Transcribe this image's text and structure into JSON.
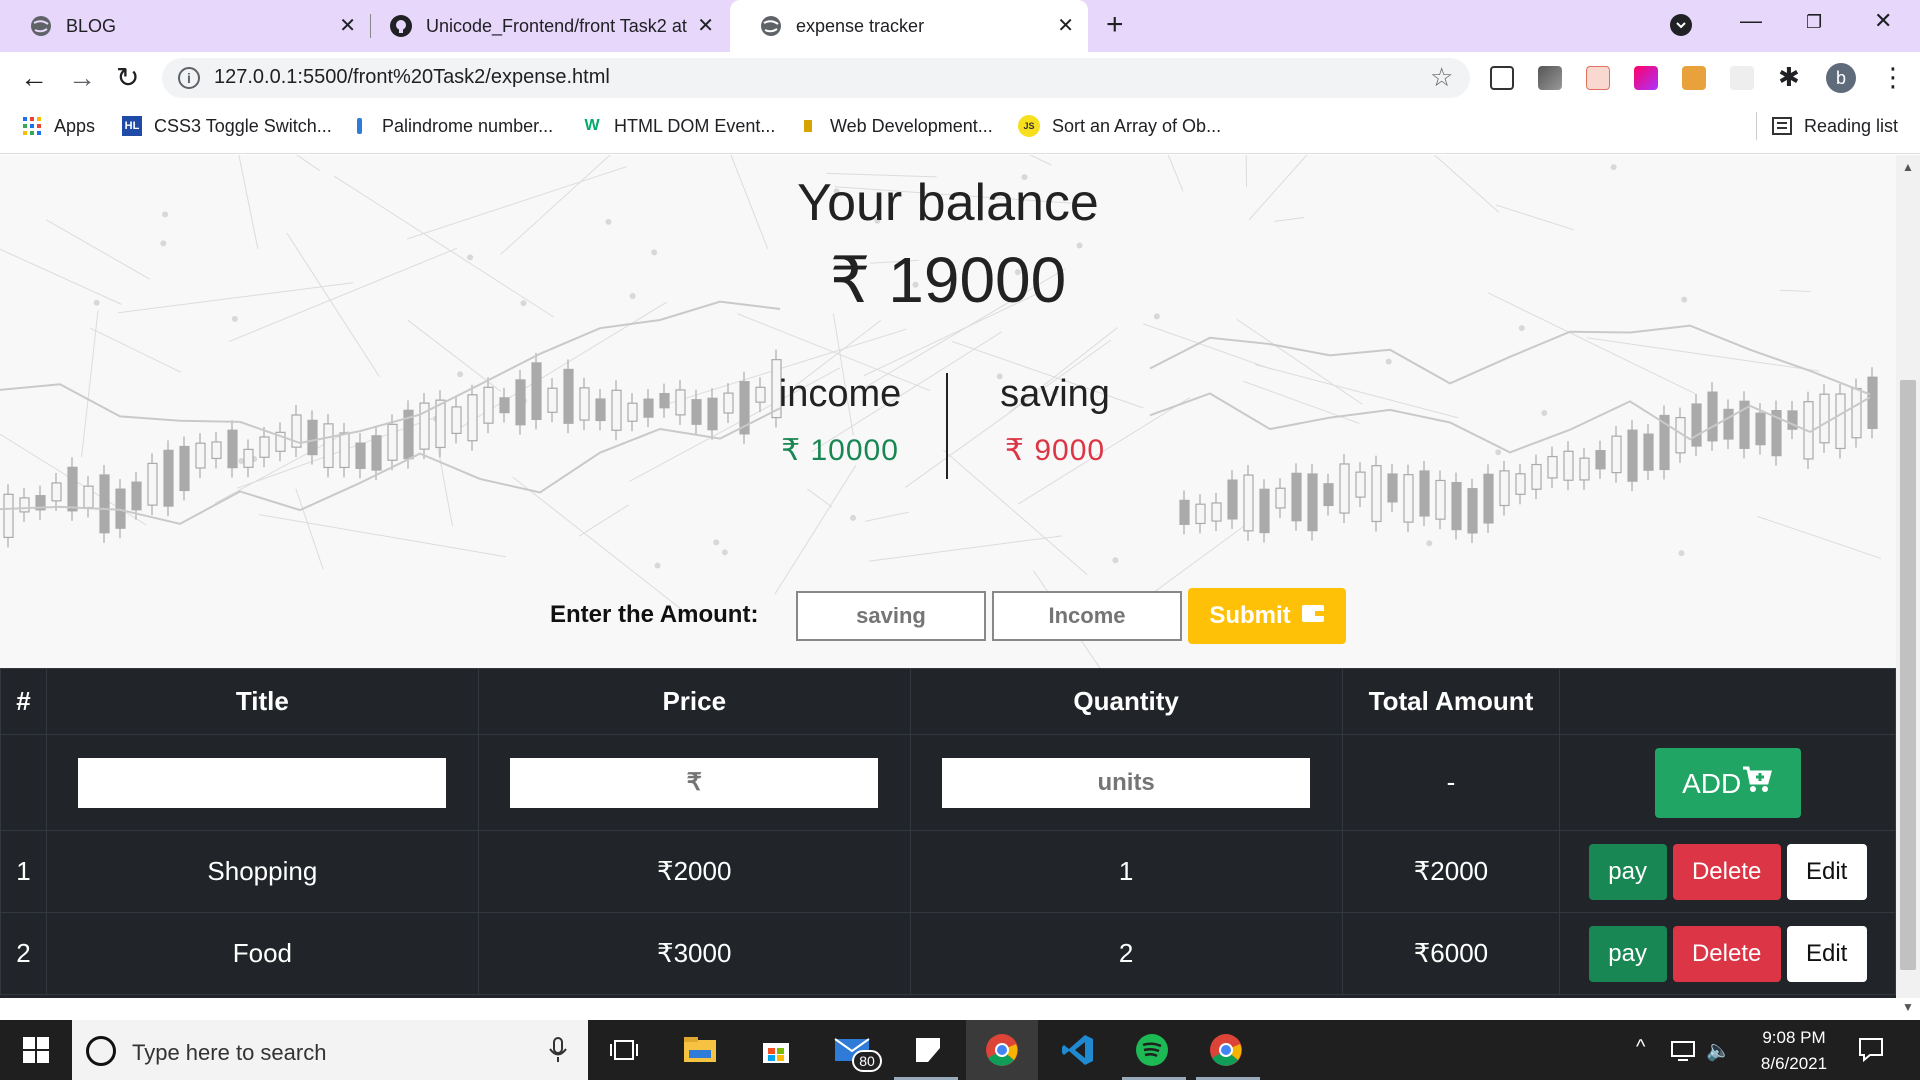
{
  "browser": {
    "tabs": [
      {
        "title": "BLOG",
        "active": false
      },
      {
        "title": "Unicode_Frontend/front Task2 at",
        "active": false
      },
      {
        "title": "expense tracker",
        "active": true
      }
    ],
    "url": "127.0.0.1:5500/front%20Task2/expense.html",
    "bookmarks": [
      {
        "label": "Apps",
        "icon": "apps-grid-icon"
      },
      {
        "label": "CSS3 Toggle Switch...",
        "icon": "hl-icon",
        "badge": "HL"
      },
      {
        "label": "Palindrome number...",
        "icon": "bookmark-icon"
      },
      {
        "label": "HTML DOM Event...",
        "icon": "w3-icon",
        "badge": "W"
      },
      {
        "label": "Web Development...",
        "icon": "bookmark-icon"
      },
      {
        "label": "Sort an Array of Ob...",
        "icon": "js-icon",
        "badge": "JS"
      }
    ],
    "reading_list": "Reading list",
    "profile_initial": "b"
  },
  "app": {
    "balance_title": "Your balance",
    "balance_value": "₹ 19000",
    "income_label": "income",
    "income_value": "₹ 10000",
    "saving_label": "saving",
    "saving_value": "₹ 9000",
    "amount_label": "Enter the Amount:",
    "saving_placeholder": "saving",
    "income_placeholder": "Income",
    "submit_label": "Submit"
  },
  "table": {
    "headers": [
      "#",
      "Title",
      "Price",
      "Quantity",
      "Total Amount",
      ""
    ],
    "input_row": {
      "title_placeholder": "",
      "price_placeholder": "₹",
      "quantity_placeholder": "units",
      "total": "-",
      "add_label": "ADD"
    },
    "rows": [
      {
        "index": "1",
        "title": "Shopping",
        "price": "₹2000",
        "quantity": "1",
        "total": "₹2000"
      },
      {
        "index": "2",
        "title": "Food",
        "price": "₹3000",
        "quantity": "2",
        "total": "₹6000"
      }
    ],
    "pay_label": "pay",
    "delete_label": "Delete",
    "edit_label": "Edit"
  },
  "taskbar": {
    "search_placeholder": "Type here to search",
    "time": "9:08 PM",
    "date": "8/6/2021",
    "mail_badge": "80"
  },
  "colors": {
    "tabstrip": "#e6d7fb",
    "income": "#198754",
    "saving": "#dc3545",
    "submit": "#ffc107",
    "table_bg": "#212529",
    "add": "#20a565"
  }
}
